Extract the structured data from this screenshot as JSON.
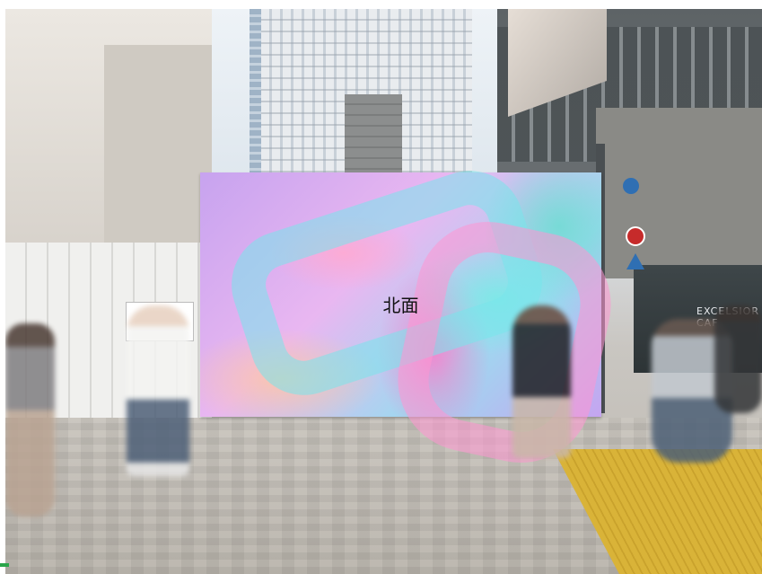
{
  "scene": {
    "description_type": "billboard mockup photo",
    "billboard_label": "北面",
    "store_sign_text": "EXCELSIOR CAF"
  },
  "colors": {
    "accent": "#2aa54a",
    "billboard_pink": "#e9b7f1",
    "billboard_cyan": "#9fd8f0",
    "tactile_paving": "#d9b338"
  }
}
